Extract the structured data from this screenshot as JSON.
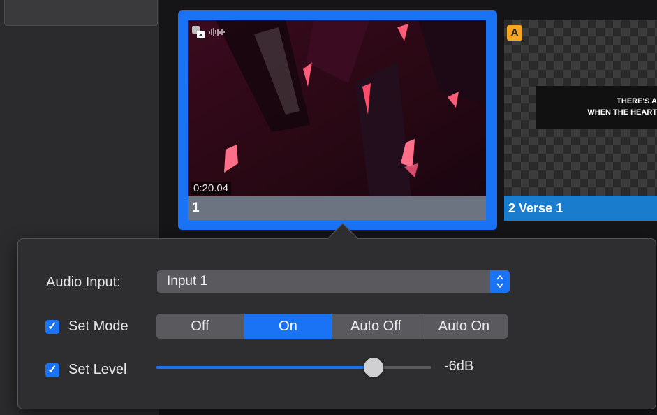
{
  "slides": [
    {
      "number": "1",
      "label": "",
      "timecode": "0:20.04",
      "selected": true
    },
    {
      "number": "2",
      "label": "Verse 1",
      "badge": "A",
      "lyrics": [
        "THERE'S A",
        "WHEN THE HEART"
      ]
    }
  ],
  "popover": {
    "audio_input_label": "Audio Input:",
    "audio_input_value": "Input 1",
    "set_mode_label": "Set Mode",
    "set_mode_checked": true,
    "modes": [
      "Off",
      "On",
      "Auto Off",
      "Auto On"
    ],
    "active_mode": "On",
    "set_level_label": "Set Level",
    "set_level_checked": true,
    "level_value": "-6dB",
    "level_fraction": 0.79
  },
  "icons": {
    "checkbox": "checkmark-icon",
    "select_arrows": "up-down-chevron-icon",
    "media": "media-layer-icon",
    "audio": "audio-waveform-icon"
  },
  "colors": {
    "accent": "#1a73f5",
    "badge": "#f5a623",
    "slide2_label": "#1a7ccc"
  }
}
